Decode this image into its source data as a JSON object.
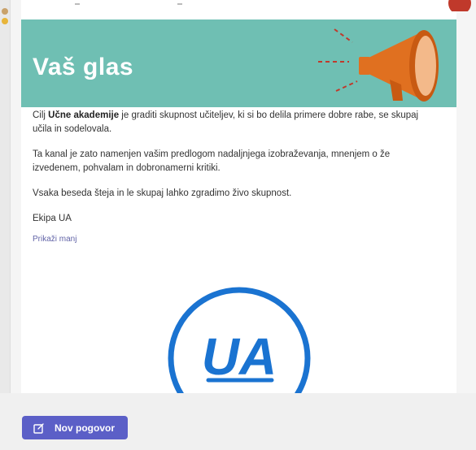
{
  "post": {
    "banner_title": "Vaš glas",
    "intro_prefix": "Cilj ",
    "intro_bold": "Učne akademije",
    "intro_rest": " je graditi skupnost učiteljev, ki si bo delila primere dobre rabe, se skupaj učila in sodelovala.",
    "paragraph_2": "Ta kanal je zato namenjen vašim predlogom nadaljnjega izobraževanja, mnenjem o že izvedenem, pohvalam in dobronamerni kritiki.",
    "paragraph_3": "Vsaka beseda šteja in le skupaj lahko zgradimo živo skupnost.",
    "signature": "Ekipa UA",
    "show_less": "Prikaži manj",
    "logo_text": "UA"
  },
  "composer": {
    "new_conversation_label": "Nov pogovor"
  },
  "colors": {
    "banner": "#6fbfb3",
    "accent": "#5b5fc7",
    "logo_blue": "#1a73d1",
    "megaphone": "#e07020"
  },
  "icons": {
    "megaphone": "megaphone-icon",
    "compose": "compose-icon"
  }
}
